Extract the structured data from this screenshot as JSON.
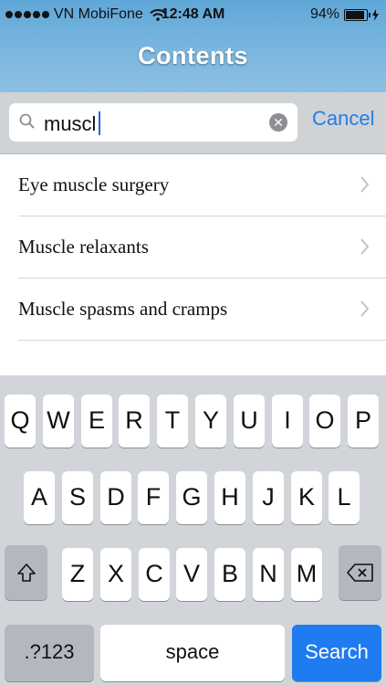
{
  "status_bar": {
    "carrier": "VN MobiFone",
    "time": "12:48 AM",
    "battery": "94%",
    "battery_level": 0.94
  },
  "nav": {
    "title": "Contents"
  },
  "search": {
    "value": "muscl",
    "cancel_label": "Cancel"
  },
  "results": [
    {
      "label": "Eye muscle surgery"
    },
    {
      "label": "Muscle relaxants"
    },
    {
      "label": "Muscle spasms and cramps"
    }
  ],
  "keyboard": {
    "row1": [
      "Q",
      "W",
      "E",
      "R",
      "T",
      "Y",
      "U",
      "I",
      "O",
      "P"
    ],
    "row2": [
      "A",
      "S",
      "D",
      "F",
      "G",
      "H",
      "J",
      "K",
      "L"
    ],
    "row3": [
      "Z",
      "X",
      "C",
      "V",
      "B",
      "N",
      "M"
    ],
    "numbers_label": ".?123",
    "space_label": "space",
    "search_label": "Search"
  },
  "colors": {
    "nav_blue": "#7bb6de",
    "accent": "#2a7be3",
    "search_key": "#1e7bf0"
  }
}
